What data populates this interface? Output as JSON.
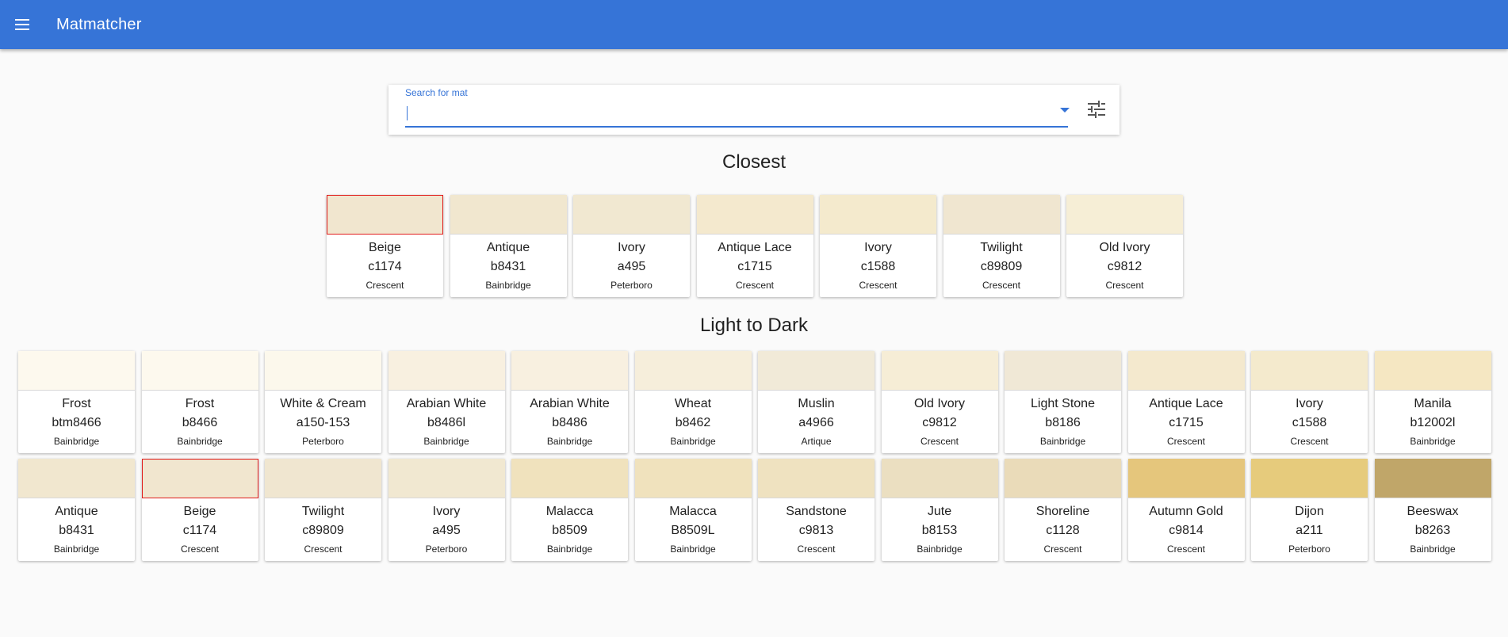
{
  "app": {
    "title": "Matmatcher"
  },
  "search": {
    "label": "Search for mat",
    "value": "",
    "placeholder": ""
  },
  "icons": {
    "menu": "menu-icon",
    "dropdown": "arrow-drop-down-icon",
    "filter": "tune-icon"
  },
  "colors": {
    "appbar": "#3674d7",
    "accent": "#3674d7",
    "selected_border": "#e01b1b"
  },
  "closest": {
    "title": "Closest",
    "items": [
      {
        "name": "Beige",
        "code": "c1174",
        "brand": "Crescent",
        "color": "#f1e6cf",
        "selected": true
      },
      {
        "name": "Antique",
        "code": "b8431",
        "brand": "Bainbridge",
        "color": "#f1e7cf"
      },
      {
        "name": "Ivory",
        "code": "a495",
        "brand": "Peterboro",
        "color": "#f1e8d1"
      },
      {
        "name": "Antique Lace",
        "code": "c1715",
        "brand": "Crescent",
        "color": "#f4e9ce"
      },
      {
        "name": "Ivory",
        "code": "c1588",
        "brand": "Crescent",
        "color": "#f4eacd"
      },
      {
        "name": "Twilight",
        "code": "c89809",
        "brand": "Crescent",
        "color": "#f0e6d0"
      },
      {
        "name": "Old Ivory",
        "code": "c9812",
        "brand": "Crescent",
        "color": "#f6eed6"
      }
    ]
  },
  "light_to_dark": {
    "title": "Light to Dark",
    "items": [
      {
        "name": "Frost",
        "code": "btm8466",
        "brand": "Bainbridge",
        "color": "#fdf9ee"
      },
      {
        "name": "Frost",
        "code": "b8466",
        "brand": "Bainbridge",
        "color": "#fdf9ee"
      },
      {
        "name": "White & Cream",
        "code": "a150-153",
        "brand": "Peterboro",
        "color": "#fcf8ec"
      },
      {
        "name": "Arabian White",
        "code": "b8486l",
        "brand": "Bainbridge",
        "color": "#f8f0e0"
      },
      {
        "name": "Arabian White",
        "code": "b8486",
        "brand": "Bainbridge",
        "color": "#f8f0e0"
      },
      {
        "name": "Wheat",
        "code": "b8462",
        "brand": "Bainbridge",
        "color": "#f6eedb"
      },
      {
        "name": "Muslin",
        "code": "a4966",
        "brand": "Artique",
        "color": "#f1ead8"
      },
      {
        "name": "Old Ivory",
        "code": "c9812",
        "brand": "Crescent",
        "color": "#f6edd6"
      },
      {
        "name": "Light Stone",
        "code": "b8186",
        "brand": "Bainbridge",
        "color": "#f0e8d6"
      },
      {
        "name": "Antique Lace",
        "code": "c1715",
        "brand": "Crescent",
        "color": "#f4e9ce"
      },
      {
        "name": "Ivory",
        "code": "c1588",
        "brand": "Crescent",
        "color": "#f4eacd"
      },
      {
        "name": "Manila",
        "code": "b12002l",
        "brand": "Bainbridge",
        "color": "#f5e7c2"
      },
      {
        "name": "Antique",
        "code": "b8431",
        "brand": "Bainbridge",
        "color": "#f1e7cf"
      },
      {
        "name": "Beige",
        "code": "c1174",
        "brand": "Crescent",
        "color": "#f1e6cf",
        "selected": true
      },
      {
        "name": "Twilight",
        "code": "c89809",
        "brand": "Crescent",
        "color": "#f0e6d0"
      },
      {
        "name": "Ivory",
        "code": "a495",
        "brand": "Peterboro",
        "color": "#f1e8d1"
      },
      {
        "name": "Malacca",
        "code": "b8509",
        "brand": "Bainbridge",
        "color": "#f0e2bd"
      },
      {
        "name": "Malacca",
        "code": "B8509L",
        "brand": "Bainbridge",
        "color": "#f0e2bd"
      },
      {
        "name": "Sandstone",
        "code": "c9813",
        "brand": "Crescent",
        "color": "#efe2c0"
      },
      {
        "name": "Jute",
        "code": "b8153",
        "brand": "Bainbridge",
        "color": "#ebdfc1"
      },
      {
        "name": "Shoreline",
        "code": "c1128",
        "brand": "Crescent",
        "color": "#eadbb9"
      },
      {
        "name": "Autumn Gold",
        "code": "c9814",
        "brand": "Crescent",
        "color": "#e5c67c"
      },
      {
        "name": "Dijon",
        "code": "a211",
        "brand": "Peterboro",
        "color": "#e6cb7c"
      },
      {
        "name": "Beeswax",
        "code": "b8263",
        "brand": "Bainbridge",
        "color": "#c0a669"
      }
    ]
  }
}
